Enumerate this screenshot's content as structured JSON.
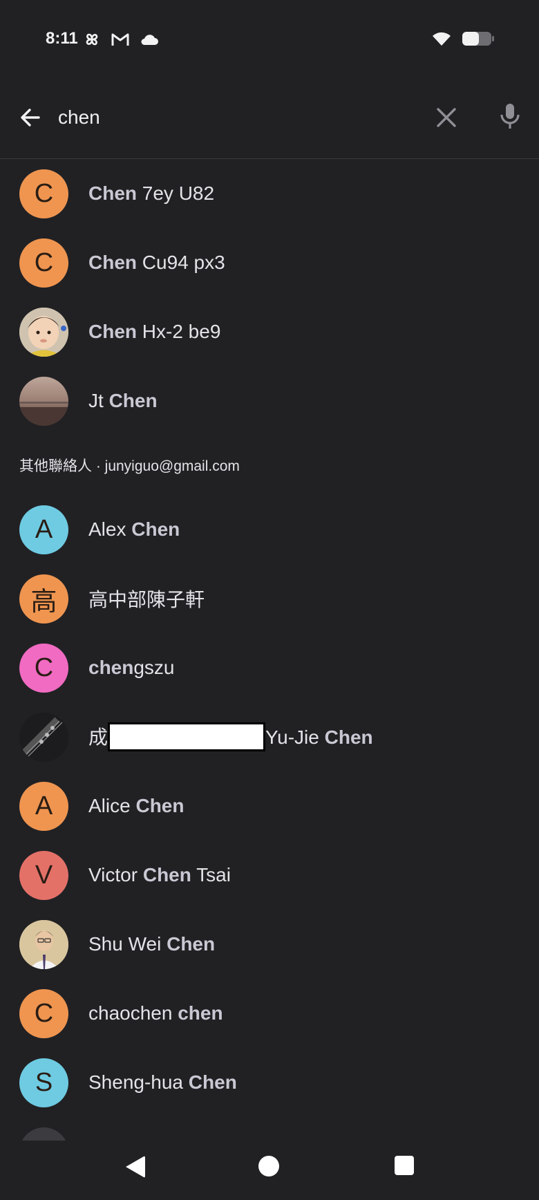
{
  "status": {
    "time": "8:11",
    "left_icons": [
      "pinwheel-icon",
      "gmail-icon",
      "cloud-icon"
    ],
    "right_icons": [
      "wifi-icon",
      "battery-icon"
    ]
  },
  "search": {
    "query": "chen",
    "back_icon": "arrow-left-icon",
    "clear_icon": "close-icon",
    "mic_icon": "mic-icon"
  },
  "contacts": [
    {
      "initial": "C",
      "color": "#ef9550",
      "pre": "",
      "match": "Chen",
      "post": " 7ey U82"
    },
    {
      "initial": "C",
      "color": "#ef9550",
      "pre": "",
      "match": "Chen",
      "post": " Cu94 px3"
    },
    {
      "initial": "",
      "photo": "baby",
      "pre": "",
      "match": "Chen",
      "post": " Hx-2 be9"
    },
    {
      "initial": "",
      "photo": "landscape",
      "pre": "Jt ",
      "match": "Chen",
      "post": ""
    }
  ],
  "other_section": {
    "header": "其他聯絡人 · junyiguo@gmail.com"
  },
  "other_contacts": [
    {
      "initial": "A",
      "color": "#6ecbe2",
      "pre": "Alex ",
      "match": "Chen",
      "post": ""
    },
    {
      "initial": "高",
      "color": "#ef9550",
      "pre": "高中部陳子軒",
      "match": "",
      "post": ""
    },
    {
      "initial": "C",
      "color": "#f06bc1",
      "pre": "",
      "match": "chen",
      "post": "gszu"
    },
    {
      "initial": "",
      "photo": "guitar",
      "pre": "成",
      "redacted": true,
      "pre2": "Yu-Jie ",
      "match": "Chen",
      "post": ""
    },
    {
      "initial": "A",
      "color": "#ef9550",
      "pre": "Alice ",
      "match": "Chen",
      "post": ""
    },
    {
      "initial": "V",
      "color": "#e47168",
      "pre": "Victor ",
      "match": "Chen",
      "post": " Tsai"
    },
    {
      "initial": "",
      "photo": "man",
      "pre": "Shu Wei ",
      "match": "Chen",
      "post": ""
    },
    {
      "initial": "C",
      "color": "#ef9550",
      "pre": "chaochen ",
      "match": "chen",
      "post": ""
    },
    {
      "initial": "S",
      "color": "#6ecbe2",
      "pre": "Sheng-hua ",
      "match": "Chen",
      "post": ""
    }
  ],
  "nav": {
    "back": "nav-back-icon",
    "home": "nav-home-icon",
    "recent": "nav-recent-icon"
  }
}
